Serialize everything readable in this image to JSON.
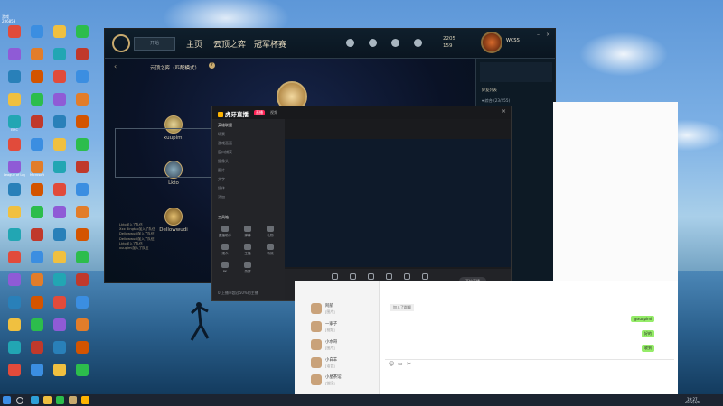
{
  "desktop": {
    "top_left": {
      "line1": "游戏",
      "line2": "286853"
    },
    "icon_rows": [
      [
        "",
        "",
        "",
        ""
      ],
      [
        "",
        "",
        "",
        ""
      ],
      [
        "",
        "",
        "",
        ""
      ],
      [
        "",
        "",
        "",
        ""
      ],
      [
        "EPIC",
        "",
        "",
        ""
      ],
      [
        "",
        "",
        "",
        ""
      ],
      [
        "League of Legends",
        "Microsoft",
        "",
        ""
      ],
      [
        "",
        "",
        "",
        ""
      ],
      [
        "",
        "",
        "",
        ""
      ],
      [
        "",
        "",
        "",
        ""
      ],
      [
        "",
        "",
        "",
        ""
      ],
      [
        "",
        "",
        "",
        ""
      ],
      [
        "",
        "",
        "",
        ""
      ],
      [
        "",
        "",
        "",
        ""
      ],
      [
        "",
        "",
        "",
        ""
      ],
      [
        "",
        "",
        "",
        ""
      ]
    ]
  },
  "lol": {
    "play_button": "开始",
    "nav": [
      "主页",
      "云顶之弈",
      "冠军杯赛"
    ],
    "currency": [
      "2205",
      "159"
    ],
    "profile_name": "WCSS",
    "mode_title": "云顶之弈（匹配模式）",
    "players": [
      "xuupimi",
      "Lkto",
      "Dellowwudi"
    ],
    "chat_lines": [
      "Lkto加入了队伍",
      "Xxx Bingtao加入了队伍",
      "Dellowwudi加入了队伍",
      "Dellowwudi加入了队伍",
      "Lkto加入了队伍",
      "xuupimi加入了队伍"
    ],
    "friends": {
      "header": "好友列表",
      "group": "▾ 综合 (23/255)",
      "online_group": "▾ 在线"
    }
  },
  "huya": {
    "app_name": "虎牙直播",
    "tabs": [
      "直播",
      "视频"
    ],
    "scene_title": "英雄联盟",
    "sidebar_items": [
      "场景",
      "游戏画面",
      "窗口捕获",
      "摄像头",
      "图片",
      "文字",
      "媒体",
      "添加"
    ],
    "tools_header": "工具箱",
    "tools": [
      "直播助手",
      "弹幕",
      "礼物",
      "观众",
      "主播",
      "特效",
      "PK",
      "录屏"
    ],
    "bottom_buttons": [
      "画面设置",
      "美颜",
      "摄像头",
      "麦克风",
      "录制",
      "音效"
    ],
    "start_live": "开始直播",
    "status_bar": "0 上播率超过50%的主播"
  },
  "chat": {
    "conversations": [
      {
        "name": "阿航",
        "preview": "[图片]"
      },
      {
        "name": "一家子",
        "preview": "[视频]"
      },
      {
        "name": "小水哥",
        "preview": "[图片]"
      },
      {
        "name": "小白羊",
        "preview": "[语音]"
      },
      {
        "name": "小星茶馆",
        "preview": "[链接]"
      }
    ],
    "bubbles": [
      "@xuupimi",
      "好的",
      "收到"
    ],
    "system_msg": "加入了群聊"
  },
  "taskbar": {
    "time": "19:27",
    "date": "2022/1/8"
  }
}
